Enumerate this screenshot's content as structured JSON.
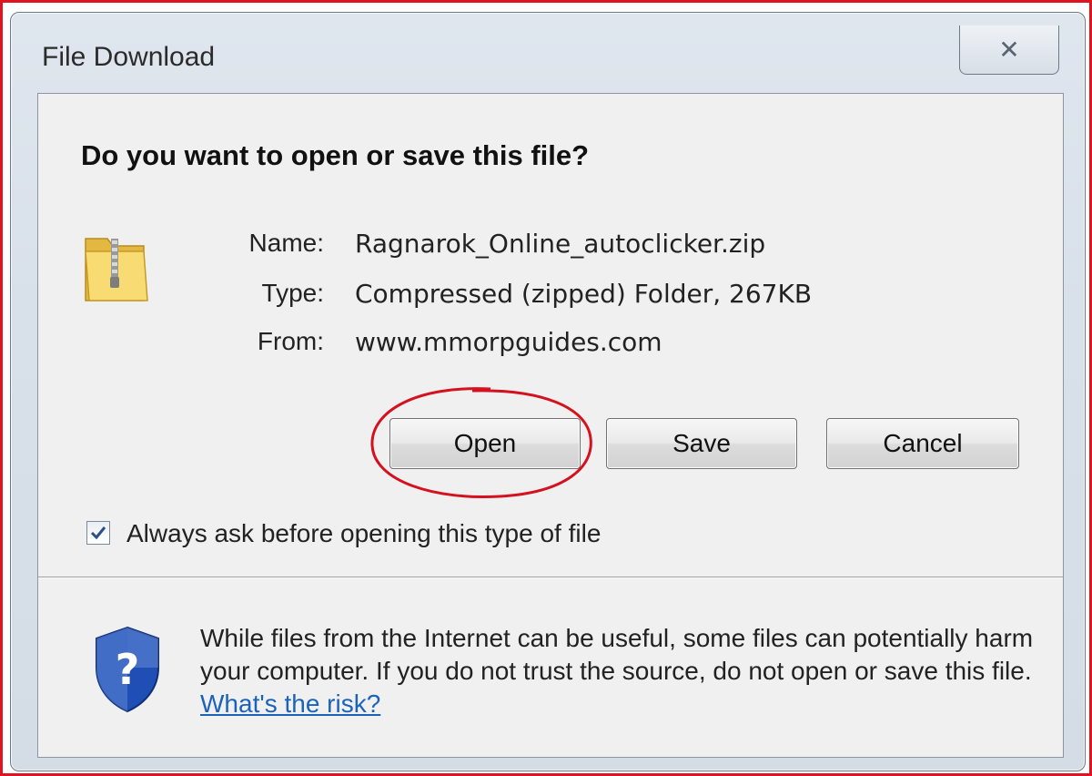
{
  "window": {
    "title": "File Download",
    "close_glyph": "✕"
  },
  "dialog": {
    "question": "Do you want to open or save this file?",
    "file": {
      "name_label": "Name:",
      "name_value": "Ragnarok_Online_autoclicker.zip",
      "type_label": "Type:",
      "type_value": "Compressed (zipped) Folder, 267KB",
      "from_label": "From:",
      "from_value": "www.mmorpguides.com"
    },
    "buttons": {
      "open": "Open",
      "save": "Save",
      "cancel": "Cancel"
    },
    "always_ask": {
      "label": "Always ask before opening this type of file",
      "checked": true
    },
    "warning": {
      "text": "While files from the Internet can be useful, some files can potentially harm your computer. If you do not trust the source, do not open or save this file.",
      "link": "What's the risk?"
    }
  },
  "icons": {
    "file": "zip-folder-icon",
    "security": "shield-question-icon"
  },
  "colors": {
    "annotation_frame": "#e0131f",
    "annotation_circle": "#d4121f",
    "link": "#1c62b8",
    "shield_blue": "#1f4fb5"
  }
}
